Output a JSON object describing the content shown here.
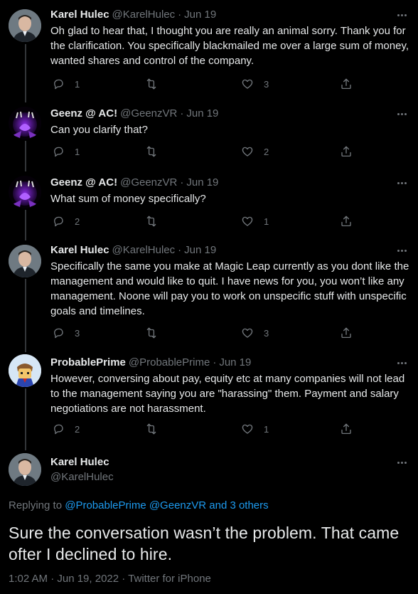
{
  "tweets": [
    {
      "name": "Karel Hulec",
      "handle": "@KarelHulec",
      "date": "Jun 19",
      "text": "Oh glad to hear that, I thought you are really an animal sorry. Thank you for the clarification. You specifically blackmailed me over a large sum of money, wanted shares and control of the company.",
      "replies": "1",
      "retweets": "",
      "likes": "3",
      "avatar": "karel"
    },
    {
      "name": "Geenz @ AC!",
      "handle": "@GeenzVR",
      "date": "Jun 19",
      "text": "Can you clarify that?",
      "replies": "1",
      "retweets": "",
      "likes": "2",
      "avatar": "geenz"
    },
    {
      "name": "Geenz @ AC!",
      "handle": "@GeenzVR",
      "date": "Jun 19",
      "text": "What sum of money specifically?",
      "replies": "2",
      "retweets": "",
      "likes": "1",
      "avatar": "geenz"
    },
    {
      "name": "Karel Hulec",
      "handle": "@KarelHulec",
      "date": "Jun 19",
      "text": "Specifically the same you make at Magic Leap currently as you dont like the management and would like to quit. I have news for you, you won’t like any management. Noone will pay you to work on unspecific stuff with unspecific goals and timelines.",
      "replies": "3",
      "retweets": "",
      "likes": "3",
      "avatar": "karel"
    },
    {
      "name": "ProbablePrime",
      "handle": "@ProbablePrime",
      "date": "Jun 19",
      "text": "However, conversing about pay, equity etc at many companies will not lead to the management saying you are \"harassing\" them. Payment and salary negotiations are not harassment.",
      "replies": "2",
      "retweets": "",
      "likes": "1",
      "avatar": "prime"
    }
  ],
  "main_tweet": {
    "name": "Karel Hulec",
    "handle": "@KarelHulec",
    "replying_prefix": "Replying to",
    "replying_to": "@ProbablePrime @GeenzVR and 3 others",
    "text": "Sure the conversation wasn’t the problem. That came ofter I declined to hire.",
    "timestamp": "1:02 AM · Jun 19, 2022 · Twitter for iPhone"
  },
  "colors": {
    "background": "#000000",
    "text": "#e7e9ea",
    "secondary": "#71767b",
    "link": "#1d9bf0",
    "thread_line": "#333639"
  },
  "icons": [
    "reply-icon",
    "retweet-icon",
    "like-icon",
    "share-icon",
    "more-icon"
  ]
}
